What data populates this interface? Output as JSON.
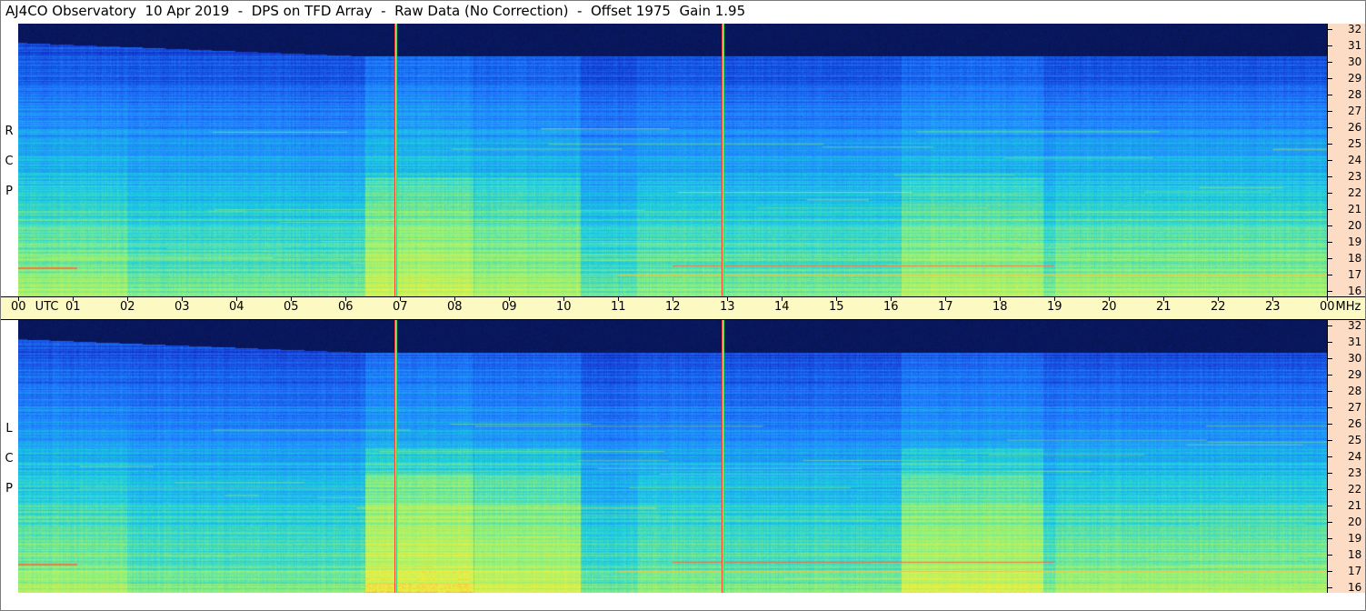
{
  "title": "AJ4CO Observatory  10 Apr 2019  -  DPS on TFD Array  -  Raw Data (No Correction)  -  Offset 1975  Gain 1.95",
  "chart_data": [
    {
      "type": "heatmap",
      "panel_label": [
        "R",
        "C",
        "P"
      ],
      "x_ticks": [
        "00",
        "01",
        "02",
        "03",
        "04",
        "05",
        "06",
        "07",
        "08",
        "09",
        "10",
        "11",
        "12",
        "13",
        "14",
        "15",
        "16",
        "17",
        "18",
        "19",
        "20",
        "21",
        "22",
        "23",
        "00"
      ],
      "x_first_label_suffix": "UTC",
      "x_last_label_suffix": "MHz",
      "xlim": [
        0,
        24
      ],
      "ylim": [
        16,
        32
      ],
      "y_ticks": [
        "32",
        "31",
        "30",
        "29",
        "28",
        "27",
        "26",
        "25",
        "24",
        "23",
        "22",
        "21",
        "20",
        "19",
        "18",
        "17",
        "16"
      ],
      "markers_utc": [
        6.9,
        12.9
      ],
      "colormap": [
        "#06103f",
        "#1230c8",
        "#1f7fff",
        "#1ccde0",
        "#8ff07a",
        "#f0f040",
        "#ff4040"
      ]
    },
    {
      "type": "heatmap",
      "panel_label": [
        "L",
        "C",
        "P"
      ],
      "xlim": [
        0,
        24
      ],
      "ylim": [
        16,
        32
      ],
      "y_ticks": [
        "32",
        "31",
        "30",
        "29",
        "28",
        "27",
        "26",
        "25",
        "24",
        "23",
        "22",
        "21",
        "20",
        "19",
        "18",
        "17",
        "16"
      ],
      "markers_utc": [
        6.9,
        12.9
      ]
    }
  ]
}
